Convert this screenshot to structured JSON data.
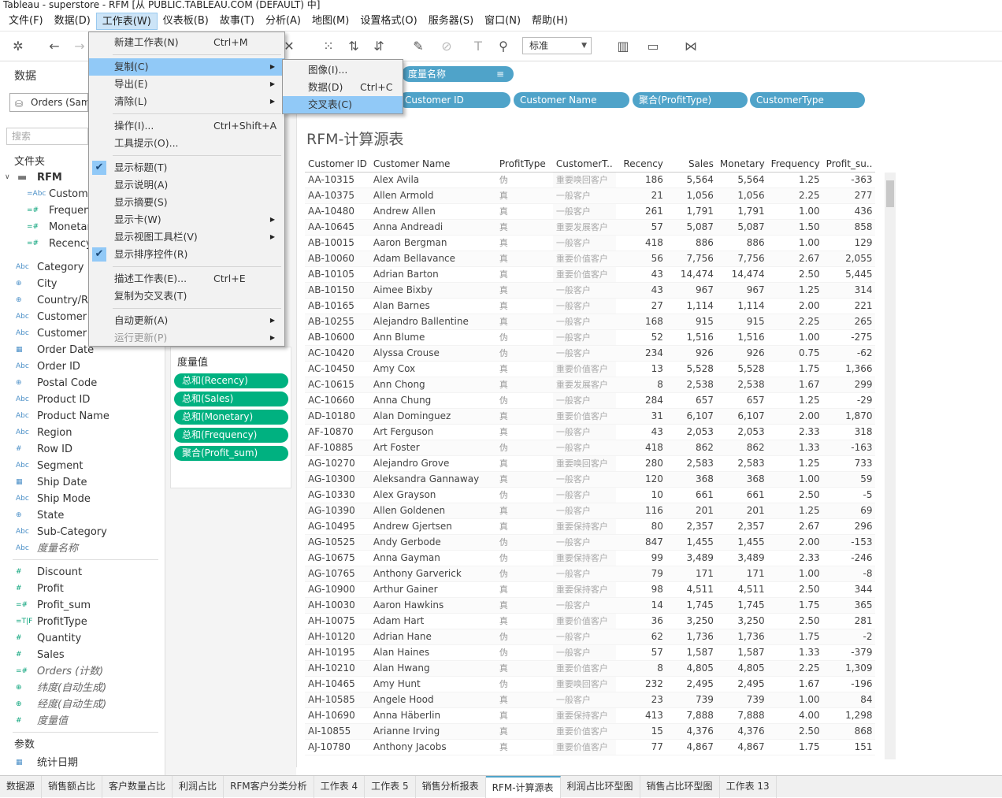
{
  "window": {
    "title": "Tableau - superstore - RFM [从 PUBLIC.TABLEAU.COM (DEFAULT) 中]"
  },
  "menubar": [
    "文件(F)",
    "数据(D)",
    "工作表(W)",
    "仪表板(B)",
    "故事(T)",
    "分析(A)",
    "地图(M)",
    "设置格式(O)",
    "服务器(S)",
    "窗口(N)",
    "帮助(H)"
  ],
  "toolbar": {
    "fit": "标准"
  },
  "leftpane": {
    "tab": "数据",
    "datasource": "Orders (Sam",
    "search_placeholder": "搜索",
    "folder_label": "文件夹",
    "rfm_folder": "RFM",
    "rfm_fields": [
      {
        "t": "=Abc",
        "n": "Custome"
      },
      {
        "t": "=#",
        "n": "Frequen"
      },
      {
        "t": "=#",
        "n": "Monetar"
      },
      {
        "t": "=#",
        "n": "Recency"
      }
    ],
    "dimensions": [
      {
        "t": "Abc",
        "n": "Category"
      },
      {
        "t": "⊕",
        "n": "City"
      },
      {
        "t": "⊕",
        "n": "Country/Re"
      },
      {
        "t": "Abc",
        "n": "Customer I"
      },
      {
        "t": "Abc",
        "n": "Customer N"
      },
      {
        "t": "▦",
        "n": "Order Date"
      },
      {
        "t": "Abc",
        "n": "Order ID"
      },
      {
        "t": "⊕",
        "n": "Postal Code"
      },
      {
        "t": "Abc",
        "n": "Product ID"
      },
      {
        "t": "Abc",
        "n": "Product Name"
      },
      {
        "t": "Abc",
        "n": "Region"
      },
      {
        "t": "#",
        "n": "Row ID"
      },
      {
        "t": "Abc",
        "n": "Segment"
      },
      {
        "t": "▦",
        "n": "Ship Date"
      },
      {
        "t": "Abc",
        "n": "Ship Mode"
      },
      {
        "t": "⊕",
        "n": "State"
      },
      {
        "t": "Abc",
        "n": "Sub-Category"
      },
      {
        "t": "Abc",
        "n": "度量名称",
        "it": true
      }
    ],
    "measures": [
      {
        "t": "#",
        "n": "Discount"
      },
      {
        "t": "#",
        "n": "Profit"
      },
      {
        "t": "=#",
        "n": "Profit_sum"
      },
      {
        "t": "=T|F",
        "n": "ProfitType"
      },
      {
        "t": "#",
        "n": "Quantity"
      },
      {
        "t": "#",
        "n": "Sales"
      },
      {
        "t": "=#",
        "n": "Orders (计数)",
        "it": true
      },
      {
        "t": "⊕",
        "n": "纬度(自动生成)",
        "it": true
      },
      {
        "t": "⊕",
        "n": "经度(自动生成)",
        "it": true
      },
      {
        "t": "#",
        "n": "度量值",
        "it": true
      }
    ],
    "params_label": "参数",
    "params": [
      {
        "t": "▦",
        "n": "统计日期"
      }
    ]
  },
  "measure_card": {
    "title": "度量值",
    "pills": [
      "总和(Recency)",
      "总和(Sales)",
      "总和(Monetary)",
      "总和(Frequency)",
      "聚合(Profit_sum)"
    ]
  },
  "shelves": {
    "columns": [
      "度量名称"
    ],
    "rows": [
      "Customer ID",
      "Customer Name",
      "聚合(ProfitType)",
      "CustomerType"
    ]
  },
  "viz": {
    "title": "RFM-计算源表",
    "headers": [
      "Customer ID",
      "Customer Name",
      "ProfitType",
      "CustomerT..",
      "Recency",
      "Sales",
      "Monetary",
      "Frequency",
      "Profit_su.."
    ],
    "rows": [
      [
        "AA-10315",
        "Alex Avila",
        "伪",
        "重要唤回客户",
        "186",
        "5,564",
        "5,564",
        "1.25",
        "-363"
      ],
      [
        "AA-10375",
        "Allen Armold",
        "真",
        "一般客户",
        "21",
        "1,056",
        "1,056",
        "2.25",
        "277"
      ],
      [
        "AA-10480",
        "Andrew Allen",
        "真",
        "一般客户",
        "261",
        "1,791",
        "1,791",
        "1.00",
        "436"
      ],
      [
        "AA-10645",
        "Anna Andreadi",
        "真",
        "重要发展客户",
        "57",
        "5,087",
        "5,087",
        "1.50",
        "858"
      ],
      [
        "AB-10015",
        "Aaron Bergman",
        "真",
        "一般客户",
        "418",
        "886",
        "886",
        "1.00",
        "129"
      ],
      [
        "AB-10060",
        "Adam Bellavance",
        "真",
        "重要价值客户",
        "56",
        "7,756",
        "7,756",
        "2.67",
        "2,055"
      ],
      [
        "AB-10105",
        "Adrian Barton",
        "真",
        "重要价值客户",
        "43",
        "14,474",
        "14,474",
        "2.50",
        "5,445"
      ],
      [
        "AB-10150",
        "Aimee Bixby",
        "真",
        "一般客户",
        "43",
        "967",
        "967",
        "1.25",
        "314"
      ],
      [
        "AB-10165",
        "Alan Barnes",
        "真",
        "一般客户",
        "27",
        "1,114",
        "1,114",
        "2.00",
        "221"
      ],
      [
        "AB-10255",
        "Alejandro Ballentine",
        "真",
        "一般客户",
        "168",
        "915",
        "915",
        "2.25",
        "265"
      ],
      [
        "AB-10600",
        "Ann Blume",
        "伪",
        "一般客户",
        "52",
        "1,516",
        "1,516",
        "1.00",
        "-275"
      ],
      [
        "AC-10420",
        "Alyssa Crouse",
        "伪",
        "一般客户",
        "234",
        "926",
        "926",
        "0.75",
        "-62"
      ],
      [
        "AC-10450",
        "Amy Cox",
        "真",
        "重要价值客户",
        "13",
        "5,528",
        "5,528",
        "1.75",
        "1,366"
      ],
      [
        "AC-10615",
        "Ann Chong",
        "真",
        "重要发展客户",
        "8",
        "2,538",
        "2,538",
        "1.67",
        "299"
      ],
      [
        "AC-10660",
        "Anna Chung",
        "伪",
        "一般客户",
        "284",
        "657",
        "657",
        "1.25",
        "-29"
      ],
      [
        "AD-10180",
        "Alan Dominguez",
        "真",
        "重要价值客户",
        "31",
        "6,107",
        "6,107",
        "2.00",
        "1,870"
      ],
      [
        "AF-10870",
        "Art Ferguson",
        "真",
        "一般客户",
        "43",
        "2,053",
        "2,053",
        "2.33",
        "318"
      ],
      [
        "AF-10885",
        "Art Foster",
        "伪",
        "一般客户",
        "418",
        "862",
        "862",
        "1.33",
        "-163"
      ],
      [
        "AG-10270",
        "Alejandro Grove",
        "真",
        "重要唤回客户",
        "280",
        "2,583",
        "2,583",
        "1.25",
        "733"
      ],
      [
        "AG-10300",
        "Aleksandra Gannaway",
        "真",
        "一般客户",
        "120",
        "368",
        "368",
        "1.00",
        "59"
      ],
      [
        "AG-10330",
        "Alex Grayson",
        "伪",
        "一般客户",
        "10",
        "661",
        "661",
        "2.50",
        "-5"
      ],
      [
        "AG-10390",
        "Allen Goldenen",
        "真",
        "一般客户",
        "116",
        "201",
        "201",
        "1.25",
        "69"
      ],
      [
        "AG-10495",
        "Andrew Gjertsen",
        "真",
        "重要保持客户",
        "80",
        "2,357",
        "2,357",
        "2.67",
        "296"
      ],
      [
        "AG-10525",
        "Andy Gerbode",
        "伪",
        "一般客户",
        "847",
        "1,455",
        "1,455",
        "2.00",
        "-153"
      ],
      [
        "AG-10675",
        "Anna Gayman",
        "伪",
        "重要保持客户",
        "99",
        "3,489",
        "3,489",
        "2.33",
        "-246"
      ],
      [
        "AG-10765",
        "Anthony Garverick",
        "伪",
        "一般客户",
        "79",
        "171",
        "171",
        "1.00",
        "-8"
      ],
      [
        "AG-10900",
        "Arthur Gainer",
        "真",
        "重要保持客户",
        "98",
        "4,511",
        "4,511",
        "2.50",
        "344"
      ],
      [
        "AH-10030",
        "Aaron Hawkins",
        "真",
        "一般客户",
        "14",
        "1,745",
        "1,745",
        "1.75",
        "365"
      ],
      [
        "AH-10075",
        "Adam Hart",
        "真",
        "重要价值客户",
        "36",
        "3,250",
        "3,250",
        "2.50",
        "281"
      ],
      [
        "AH-10120",
        "Adrian Hane",
        "伪",
        "一般客户",
        "62",
        "1,736",
        "1,736",
        "1.75",
        "-2"
      ],
      [
        "AH-10195",
        "Alan Haines",
        "伪",
        "一般客户",
        "57",
        "1,587",
        "1,587",
        "1.33",
        "-379"
      ],
      [
        "AH-10210",
        "Alan Hwang",
        "真",
        "重要价值客户",
        "8",
        "4,805",
        "4,805",
        "2.25",
        "1,309"
      ],
      [
        "AH-10465",
        "Amy Hunt",
        "伪",
        "重要唤回客户",
        "232",
        "2,495",
        "2,495",
        "1.67",
        "-196"
      ],
      [
        "AH-10585",
        "Angele Hood",
        "真",
        "一般客户",
        "23",
        "739",
        "739",
        "1.00",
        "84"
      ],
      [
        "AH-10690",
        "Anna Häberlin",
        "真",
        "重要保持客户",
        "413",
        "7,888",
        "7,888",
        "4.00",
        "1,298"
      ],
      [
        "AI-10855",
        "Arianne Irving",
        "真",
        "重要价值客户",
        "15",
        "4,376",
        "4,376",
        "2.50",
        "868"
      ],
      [
        "AJ-10780",
        "Anthony Jacobs",
        "真",
        "重要价值客户",
        "77",
        "4,867",
        "4,867",
        "1.75",
        "151"
      ]
    ]
  },
  "statusbar": [
    "数据源",
    "销售额占比",
    "客户数量占比",
    "利润占比",
    "RFM客户分类分析",
    "工作表 4",
    "工作表 5",
    "销售分析报表",
    "RFM-计算源表",
    "利润占比环型图",
    "销售占比环型图",
    "工作表 13"
  ],
  "statusbar_active": "RFM-计算源表",
  "worksheet_menu": {
    "items": [
      {
        "label": "新建工作表(N)",
        "sc": "Ctrl+M"
      },
      {
        "sep": true
      },
      {
        "label": "复制(C)",
        "sub": true,
        "hl": true
      },
      {
        "label": "导出(E)",
        "sub": true
      },
      {
        "label": "清除(L)",
        "sub": true
      },
      {
        "sep": true
      },
      {
        "label": "操作(I)...",
        "sc": "Ctrl+Shift+A"
      },
      {
        "label": "工具提示(O)..."
      },
      {
        "sep": true
      },
      {
        "label": "显示标题(T)",
        "chk": true
      },
      {
        "label": "显示说明(A)"
      },
      {
        "label": "显示摘要(S)"
      },
      {
        "label": "显示卡(W)",
        "sub": true
      },
      {
        "label": "显示视图工具栏(V)",
        "sub": true
      },
      {
        "label": "显示排序控件(R)",
        "chk": true
      },
      {
        "sep": true
      },
      {
        "label": "描述工作表(E)...",
        "sc": "Ctrl+E"
      },
      {
        "label": "复制为交叉表(T)"
      },
      {
        "sep": true
      },
      {
        "label": "自动更新(A)",
        "sub": true
      },
      {
        "label": "运行更新(P)",
        "sub": true,
        "dis": true
      }
    ]
  },
  "copy_submenu": {
    "items": [
      {
        "label": "图像(I)..."
      },
      {
        "label": "数据(D)",
        "sc": "Ctrl+C"
      },
      {
        "label": "交叉表(C)",
        "hl": true
      }
    ]
  }
}
